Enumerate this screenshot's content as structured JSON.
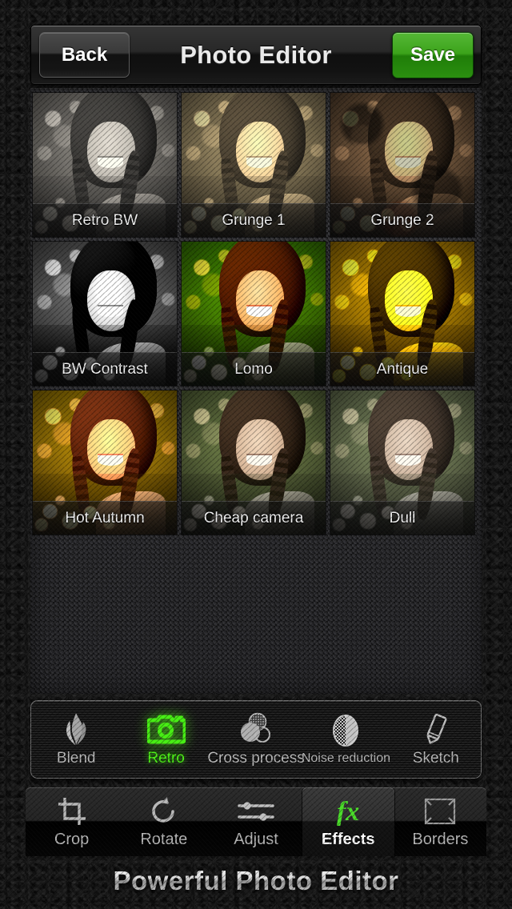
{
  "header": {
    "title": "Photo Editor",
    "back_label": "Back",
    "save_label": "Save",
    "save_color": "#3ca31b"
  },
  "filters": {
    "items": [
      {
        "label": "Retro BW",
        "key": "retrobw"
      },
      {
        "label": "Grunge 1",
        "key": "grunge1"
      },
      {
        "label": "Grunge 2",
        "key": "grunge2"
      },
      {
        "label": "BW Contrast",
        "key": "bwcontrast"
      },
      {
        "label": "Lomo",
        "key": "lomo"
      },
      {
        "label": "Antique",
        "key": "antique"
      },
      {
        "label": "Hot Autumn",
        "key": "hotautumn"
      },
      {
        "label": "Cheap camera",
        "key": "cheap"
      },
      {
        "label": "Dull",
        "key": "dull"
      }
    ]
  },
  "effect_categories": {
    "selected": "Retro",
    "accent_color": "#4ff01a",
    "items": [
      {
        "label": "Blend",
        "icon": "flame-icon",
        "selected": false
      },
      {
        "label": "Retro",
        "icon": "camera-icon",
        "selected": true
      },
      {
        "label": "Cross process",
        "icon": "overlapping-circles-icon",
        "selected": false
      },
      {
        "label": "Noise reduction",
        "icon": "half-checker-circle-icon",
        "selected": false
      },
      {
        "label": "Sketch",
        "icon": "pencil-icon",
        "selected": false
      }
    ]
  },
  "tabs": {
    "selected": "Effects",
    "items": [
      {
        "label": "Crop",
        "icon": "crop-icon",
        "selected": false
      },
      {
        "label": "Rotate",
        "icon": "rotate-icon",
        "selected": false
      },
      {
        "label": "Adjust",
        "icon": "sliders-icon",
        "selected": false
      },
      {
        "label": "Effects",
        "icon": "fx-icon",
        "selected": true
      },
      {
        "label": "Borders",
        "icon": "frame-icon",
        "selected": false
      }
    ]
  },
  "footer": {
    "caption": "Powerful Photo Editor"
  }
}
